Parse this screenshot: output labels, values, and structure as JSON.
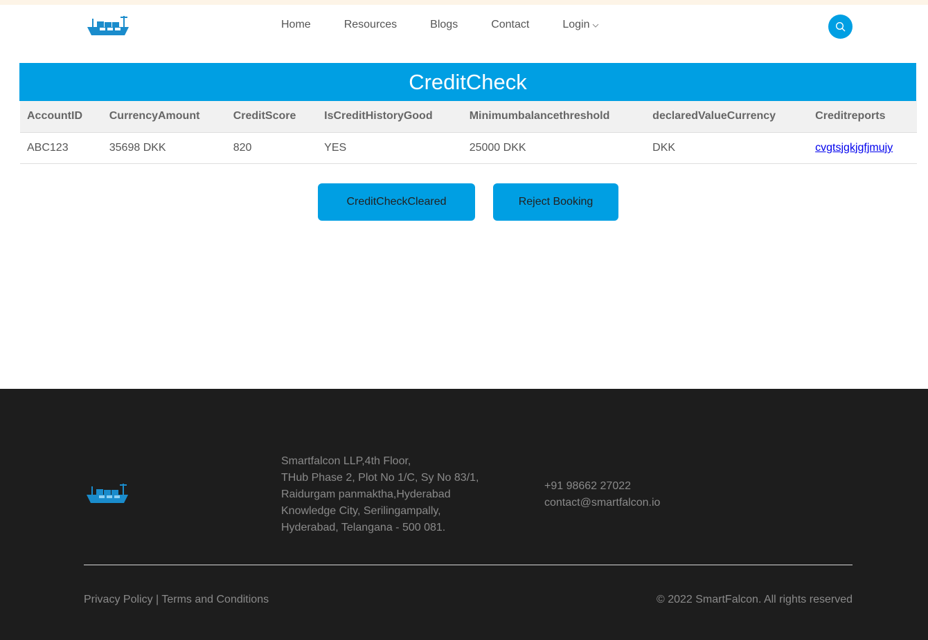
{
  "nav": {
    "items": [
      {
        "label": "Home"
      },
      {
        "label": "Resources"
      },
      {
        "label": "Blogs"
      },
      {
        "label": "Contact"
      },
      {
        "label": "Login"
      }
    ]
  },
  "page": {
    "title": "CreditCheck"
  },
  "table": {
    "headers": [
      "AccountID",
      "CurrencyAmount",
      "CreditScore",
      "IsCreditHistoryGood",
      "Minimumbalancethreshold",
      "declaredValueCurrency",
      "Creditreports"
    ],
    "row": [
      "ABC123",
      "35698 DKK",
      "820",
      "YES",
      "25000 DKK",
      "DKK",
      "cvgtsjgkjgfjmujy"
    ]
  },
  "actions": {
    "clear_label": "CreditCheckCleared",
    "reject_label": "Reject Booking"
  },
  "footer": {
    "address_lines": [
      "Smartfalcon LLP,4th Floor,",
      "THub Phase 2, Plot No 1/C, Sy No 83/1,",
      "Raidurgam panmaktha,Hyderabad",
      "Knowledge City, Serilingampally,",
      "Hyderabad, Telangana - 500 081."
    ],
    "phone": "+91 98662 27022",
    "email": "contact@smartfalcon.io",
    "privacy": "Privacy Policy",
    "separator": "|",
    "terms": "Terms and Conditions",
    "copyright": "© 2022 SmartFalcon. All rights reserved"
  },
  "colors": {
    "accent": "#009fe3",
    "footer_bg": "#1d1d1d",
    "top_strip": "#fdf4e7"
  },
  "icons": {
    "logo": "ship-logo-icon",
    "search": "search-icon",
    "dropdown": "chevron-down-icon"
  }
}
